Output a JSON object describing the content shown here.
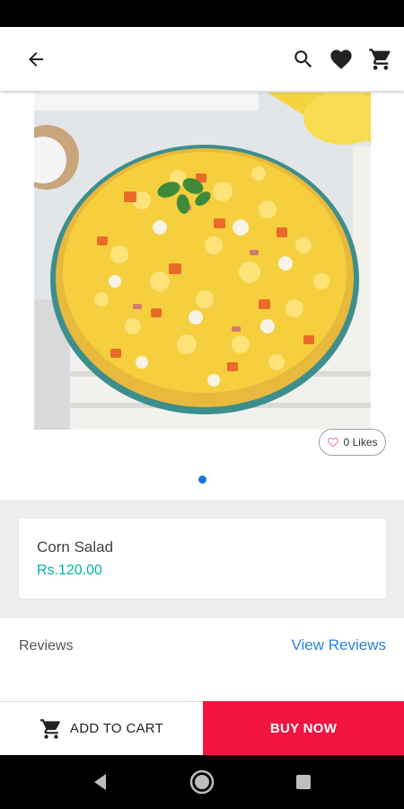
{
  "app_bar": {
    "icons": {
      "back": "arrow-back-icon",
      "search": "search-icon",
      "favorites": "heart-icon",
      "cart": "cart-icon"
    }
  },
  "product": {
    "image_alt": "bowl-of-corn-salad",
    "likes_label": "0 Likes",
    "name": "Corn Salad",
    "price": "Rs.120.00",
    "price_color": "#00b3a7"
  },
  "gallery": {
    "page_count": 1,
    "active_index": 0,
    "indicator_color": "#1976d2"
  },
  "reviews": {
    "label": "Reviews",
    "link_label": "View Reviews",
    "link_color": "#2f7fe0"
  },
  "actions": {
    "add_to_cart_label": "ADD TO CART",
    "buy_now_label": "BUY NOW",
    "buy_now_color": "#f0143f"
  },
  "system_nav": {
    "icons": [
      "nav-back-icon",
      "nav-home-icon",
      "nav-recents-icon"
    ]
  }
}
